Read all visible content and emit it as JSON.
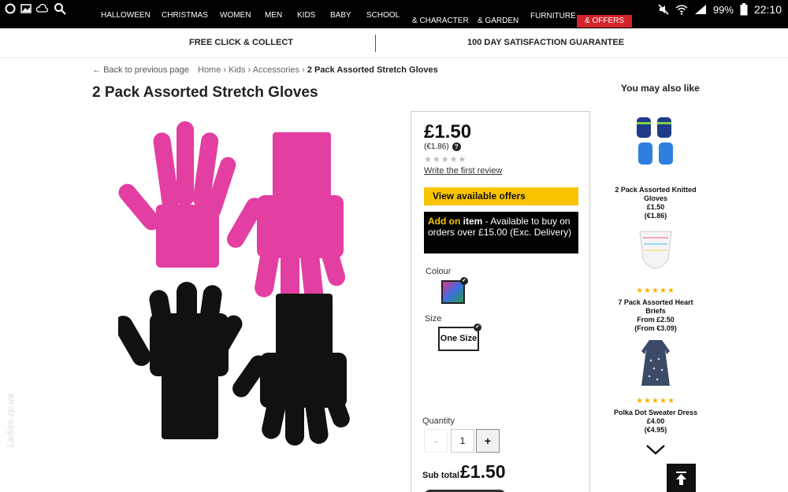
{
  "status_bar": {
    "battery": "99%",
    "time": "22:10"
  },
  "nav": {
    "items": [
      {
        "label": "HALLOWEEN"
      },
      {
        "label": "CHRISTMAS"
      },
      {
        "label": "WOMEN"
      },
      {
        "label": "MEN"
      },
      {
        "label": "KIDS"
      },
      {
        "label": "BABY"
      },
      {
        "label": "SCHOOL"
      },
      {
        "label": "& CHARACTER"
      },
      {
        "label": "& GARDEN"
      },
      {
        "label": "FURNITURE"
      }
    ],
    "offers": "& OFFERS"
  },
  "promo": {
    "left": "FREE CLICK & COLLECT",
    "right": "100 DAY SATISFACTION GUARANTEE"
  },
  "breadcrumb": {
    "back": "Back to previous page",
    "home": "Home",
    "kids": "Kids",
    "accessories": "Accessories",
    "current": "2 Pack Assorted Stretch Gloves",
    "sep": "›"
  },
  "product": {
    "title": "2 Pack Assorted Stretch Gloves",
    "price": "£1.50",
    "price_euro": "(€1.86)",
    "help": "?",
    "rating_stars": "★★★★★",
    "review_link": "Write the first review",
    "offers_button": "View available offers",
    "addon": {
      "prefix": "Add on",
      "item": "item",
      "rest": " - Available to buy on orders over £15.00 (Exc. Delivery)"
    },
    "colour_label": "Colour",
    "size_label": "Size",
    "size_value": "One Size",
    "quantity_label": "Quantity",
    "qty_minus": "-",
    "qty_value": "1",
    "qty_plus": "+",
    "subtotal_label": "Sub total",
    "subtotal_value": "£1.50",
    "check": "✔"
  },
  "recommendations": {
    "title": "You may also like",
    "items": [
      {
        "name": "2 Pack Assorted Knitted Gloves",
        "price": "£1.50",
        "euro": "(€1.86)",
        "stars": ""
      },
      {
        "name": "7 Pack Assorted Heart Briefs",
        "price": "From £2.50",
        "euro": "(From €3.09)",
        "stars": "★★★★★"
      },
      {
        "name": "Polka Dot Sweater Dress",
        "price": "£4.00",
        "euro": "(€4.95)",
        "stars": "★★★★★"
      }
    ]
  },
  "watermark": "Ladies-zp.ua"
}
